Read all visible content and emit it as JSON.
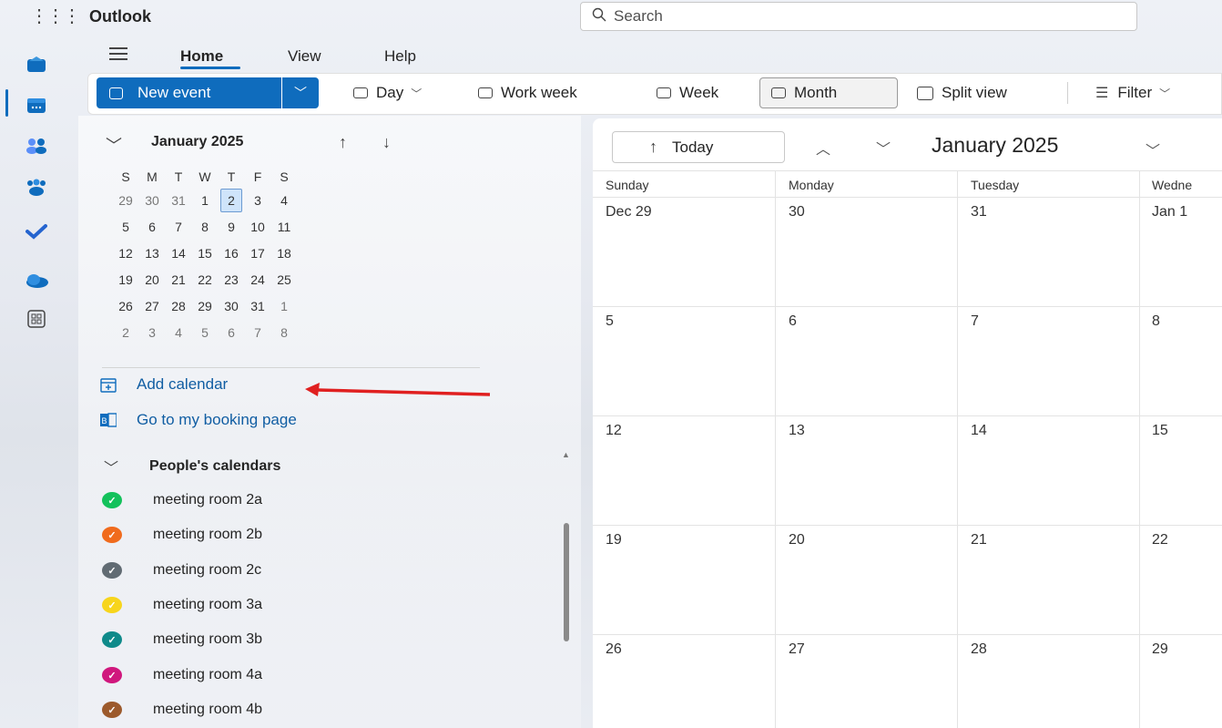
{
  "app": {
    "title": "Outlook"
  },
  "search": {
    "placeholder": "Search"
  },
  "ribbon": {
    "tabs": [
      "Home",
      "View",
      "Help"
    ]
  },
  "commands": {
    "new_event": "New event",
    "day": "Day",
    "work_week": "Work week",
    "week": "Week",
    "month": "Month",
    "split_view": "Split view",
    "filter": "Filter"
  },
  "mini_calendar": {
    "title": "January 2025",
    "weekdays": [
      "S",
      "M",
      "T",
      "W",
      "T",
      "F",
      "S"
    ],
    "weeks": [
      [
        "29",
        "30",
        "31",
        "1",
        "2",
        "3",
        "4"
      ],
      [
        "5",
        "6",
        "7",
        "8",
        "9",
        "10",
        "11"
      ],
      [
        "12",
        "13",
        "14",
        "15",
        "16",
        "17",
        "18"
      ],
      [
        "19",
        "20",
        "21",
        "22",
        "23",
        "24",
        "25"
      ],
      [
        "26",
        "27",
        "28",
        "29",
        "30",
        "31",
        "1"
      ],
      [
        "2",
        "3",
        "4",
        "5",
        "6",
        "7",
        "8"
      ]
    ],
    "selected": "2"
  },
  "sidebar_links": {
    "add_calendar": "Add calendar",
    "booking_page": "Go to my booking page"
  },
  "people_calendars": {
    "header": "People's calendars",
    "items": [
      {
        "label": "meeting room 2a",
        "color": "#13c15b"
      },
      {
        "label": "meeting room 2b",
        "color": "#f06b1d"
      },
      {
        "label": "meeting room 2c",
        "color": "#616b73"
      },
      {
        "label": "meeting room 3a",
        "color": "#f7d51c"
      },
      {
        "label": "meeting room 3b",
        "color": "#0f8a8a"
      },
      {
        "label": "meeting room 4a",
        "color": "#d0177d"
      },
      {
        "label": "meeting room 4b",
        "color": "#9c5a2c"
      }
    ]
  },
  "calendar": {
    "today_button": "Today",
    "title": "January 2025",
    "weekday_headers": [
      "Sunday",
      "Monday",
      "Tuesday",
      "Wedne"
    ],
    "weeks": [
      [
        "Dec 29",
        "30",
        "31",
        "Jan 1"
      ],
      [
        "5",
        "6",
        "7",
        "8"
      ],
      [
        "12",
        "13",
        "14",
        "15"
      ],
      [
        "19",
        "20",
        "21",
        "22"
      ],
      [
        "26",
        "27",
        "28",
        "29"
      ]
    ]
  },
  "colors": {
    "accent": "#0f6cbd",
    "annotation_arrow": "#e02020"
  }
}
